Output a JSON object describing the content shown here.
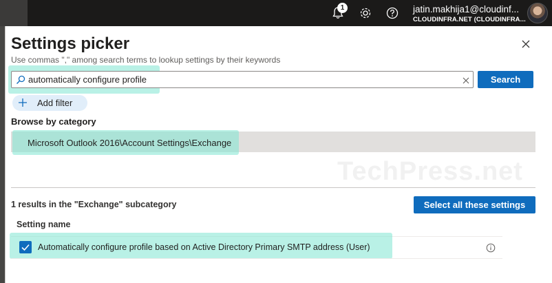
{
  "header": {
    "notification_count": "1",
    "user_name": "jatin.makhija1@cloudinf...",
    "user_org": "CLOUDINFRA.NET (CLOUDINFRA...",
    "icons": [
      "bell-icon",
      "gear-icon",
      "help-icon",
      "avatar"
    ]
  },
  "panel": {
    "title": "Settings picker",
    "subtitle": "Use commas \",\" among search terms to lookup settings by their keywords"
  },
  "search": {
    "value": "automatically configure profile",
    "button_label": "Search"
  },
  "filter": {
    "add_label": "Add filter"
  },
  "browse": {
    "label": "Browse by category",
    "category": "Microsoft Outlook 2016\\Account Settings\\Exchange"
  },
  "watermark": "TechPress.net",
  "results": {
    "summary": "1 results in the \"Exchange\" subcategory",
    "select_all_label": "Select all these settings",
    "column_header": "Setting name",
    "items": [
      {
        "label": "Automatically configure profile based on Active Directory Primary SMTP address (User)",
        "checked": true
      }
    ]
  },
  "colors": {
    "primary": "#0f6cbd",
    "highlight": "#80e6d2",
    "topbar": "#1b1a19"
  }
}
